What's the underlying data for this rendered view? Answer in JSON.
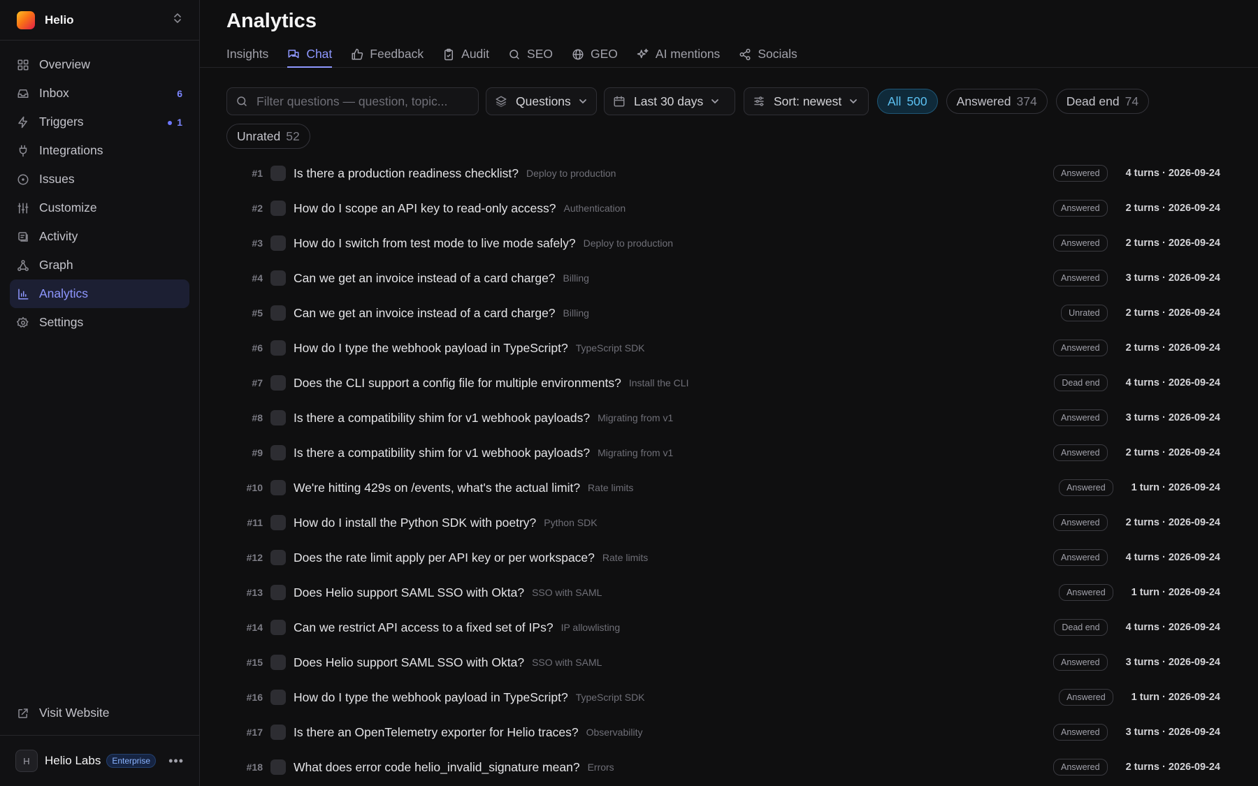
{
  "workspace": {
    "name": "Helio"
  },
  "sidebar": {
    "items": [
      {
        "key": "overview",
        "label": "Overview",
        "icon": "grid-icon",
        "count": null,
        "dot": false,
        "active": false
      },
      {
        "key": "inbox",
        "label": "Inbox",
        "icon": "inbox-icon",
        "count": "6",
        "dot": false,
        "active": false
      },
      {
        "key": "triggers",
        "label": "Triggers",
        "icon": "bolt-icon",
        "count": "1",
        "dot": true,
        "active": false
      },
      {
        "key": "integrations",
        "label": "Integrations",
        "icon": "plug-icon",
        "count": null,
        "dot": false,
        "active": false
      },
      {
        "key": "issues",
        "label": "Issues",
        "icon": "alert-circle-icon",
        "count": null,
        "dot": false,
        "active": false
      },
      {
        "key": "customize",
        "label": "Customize",
        "icon": "sliders-icon",
        "count": null,
        "dot": false,
        "active": false
      },
      {
        "key": "activity",
        "label": "Activity",
        "icon": "activity-icon",
        "count": null,
        "dot": false,
        "active": false
      },
      {
        "key": "graph",
        "label": "Graph",
        "icon": "graph-icon",
        "count": null,
        "dot": false,
        "active": false
      },
      {
        "key": "analytics",
        "label": "Analytics",
        "icon": "bar-chart-icon",
        "count": null,
        "dot": false,
        "active": true
      },
      {
        "key": "settings",
        "label": "Settings",
        "icon": "gear-icon",
        "count": null,
        "dot": false,
        "active": false
      }
    ],
    "visit_website": "Visit Website",
    "account": {
      "initial": "H",
      "name": "Helio Labs",
      "plan": "Enterprise"
    }
  },
  "page": {
    "title": "Analytics"
  },
  "tabs": [
    {
      "key": "insights",
      "label": "Insights",
      "icon": null,
      "active": false
    },
    {
      "key": "chat",
      "label": "Chat",
      "icon": "chat-icon",
      "active": true
    },
    {
      "key": "feedback",
      "label": "Feedback",
      "icon": "thumbs-up-icon",
      "active": false
    },
    {
      "key": "audit",
      "label": "Audit",
      "icon": "clipboard-icon",
      "active": false
    },
    {
      "key": "seo",
      "label": "SEO",
      "icon": "search-icon",
      "active": false
    },
    {
      "key": "geo",
      "label": "GEO",
      "icon": "globe-icon",
      "active": false
    },
    {
      "key": "ai-mentions",
      "label": "AI mentions",
      "icon": "sparkles-icon",
      "active": false
    },
    {
      "key": "socials",
      "label": "Socials",
      "icon": "share-icon",
      "active": false
    }
  ],
  "filters": {
    "search_placeholder": "Filter questions — question, topic...",
    "search_value": "",
    "type": "Questions",
    "range": "Last 30 days",
    "sort": "Sort: newest",
    "pills": [
      {
        "label": "All",
        "count": "500",
        "active": true
      },
      {
        "label": "Answered",
        "count": "374",
        "active": false
      },
      {
        "label": "Dead end",
        "count": "74",
        "active": false
      },
      {
        "label": "Unrated",
        "count": "52",
        "active": false
      }
    ]
  },
  "questions": [
    {
      "num": "#1",
      "q": "Is there a production readiness checklist?",
      "topic": "Deploy to production",
      "status": "Answered",
      "meta": "4 turns · 2026-09-24"
    },
    {
      "num": "#2",
      "q": "How do I scope an API key to read-only access?",
      "topic": "Authentication",
      "status": "Answered",
      "meta": "2 turns · 2026-09-24"
    },
    {
      "num": "#3",
      "q": "How do I switch from test mode to live mode safely?",
      "topic": "Deploy to production",
      "status": "Answered",
      "meta": "2 turns · 2026-09-24"
    },
    {
      "num": "#4",
      "q": "Can we get an invoice instead of a card charge?",
      "topic": "Billing",
      "status": "Answered",
      "meta": "3 turns · 2026-09-24"
    },
    {
      "num": "#5",
      "q": "Can we get an invoice instead of a card charge?",
      "topic": "Billing",
      "status": "Unrated",
      "meta": "2 turns · 2026-09-24"
    },
    {
      "num": "#6",
      "q": "How do I type the webhook payload in TypeScript?",
      "topic": "TypeScript SDK",
      "status": "Answered",
      "meta": "2 turns · 2026-09-24"
    },
    {
      "num": "#7",
      "q": "Does the CLI support a config file for multiple environments?",
      "topic": "Install the CLI",
      "status": "Dead end",
      "meta": "4 turns · 2026-09-24"
    },
    {
      "num": "#8",
      "q": "Is there a compatibility shim for v1 webhook payloads?",
      "topic": "Migrating from v1",
      "status": "Answered",
      "meta": "3 turns · 2026-09-24"
    },
    {
      "num": "#9",
      "q": "Is there a compatibility shim for v1 webhook payloads?",
      "topic": "Migrating from v1",
      "status": "Answered",
      "meta": "2 turns · 2026-09-24"
    },
    {
      "num": "#10",
      "q": "We're hitting 429s on /events, what's the actual limit?",
      "topic": "Rate limits",
      "status": "Answered",
      "meta": "1 turn · 2026-09-24"
    },
    {
      "num": "#11",
      "q": "How do I install the Python SDK with poetry?",
      "topic": "Python SDK",
      "status": "Answered",
      "meta": "2 turns · 2026-09-24"
    },
    {
      "num": "#12",
      "q": "Does the rate limit apply per API key or per workspace?",
      "topic": "Rate limits",
      "status": "Answered",
      "meta": "4 turns · 2026-09-24"
    },
    {
      "num": "#13",
      "q": "Does Helio support SAML SSO with Okta?",
      "topic": "SSO with SAML",
      "status": "Answered",
      "meta": "1 turn · 2026-09-24"
    },
    {
      "num": "#14",
      "q": "Can we restrict API access to a fixed set of IPs?",
      "topic": "IP allowlisting",
      "status": "Dead end",
      "meta": "4 turns · 2026-09-24"
    },
    {
      "num": "#15",
      "q": "Does Helio support SAML SSO with Okta?",
      "topic": "SSO with SAML",
      "status": "Answered",
      "meta": "3 turns · 2026-09-24"
    },
    {
      "num": "#16",
      "q": "How do I type the webhook payload in TypeScript?",
      "topic": "TypeScript SDK",
      "status": "Answered",
      "meta": "1 turn · 2026-09-24"
    },
    {
      "num": "#17",
      "q": "Is there an OpenTelemetry exporter for Helio traces?",
      "topic": "Observability",
      "status": "Answered",
      "meta": "3 turns · 2026-09-24"
    },
    {
      "num": "#18",
      "q": "What does error code helio_invalid_signature mean?",
      "topic": "Errors",
      "status": "Answered",
      "meta": "2 turns · 2026-09-24"
    }
  ]
}
